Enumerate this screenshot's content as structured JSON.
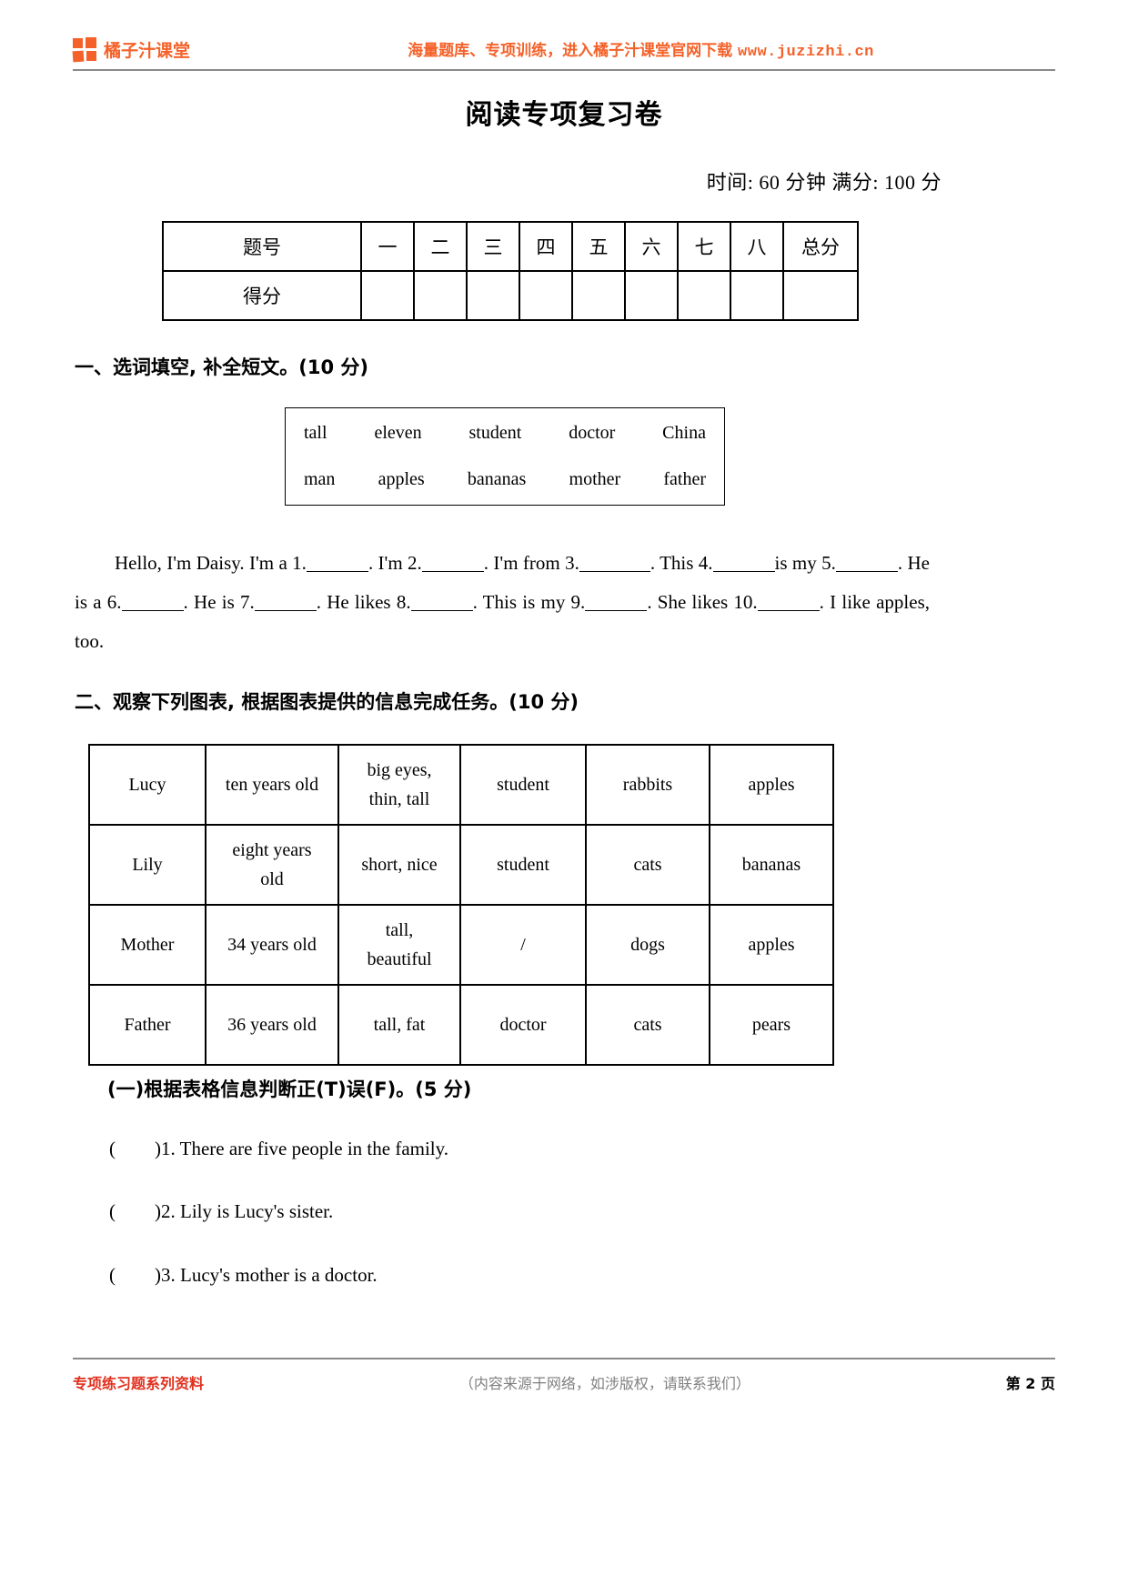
{
  "header": {
    "brand_name": "橘子汁课堂",
    "logo_icon": "four-square-grid-icon",
    "slogan": "海量题库、专项训练，进入橘子汁课堂官网下载",
    "url": "www.juzizhi.cn",
    "brand_color": "#f4622a"
  },
  "title": "阅读专项复习卷",
  "meta": "时间: 60 分钟    满分: 100 分",
  "score_table": {
    "row_labels": [
      "题号",
      "得分"
    ],
    "columns": [
      "一",
      "二",
      "三",
      "四",
      "五",
      "六",
      "七",
      "八",
      "总分"
    ],
    "scores": [
      "",
      "",
      "",
      "",
      "",
      "",
      "",
      "",
      ""
    ]
  },
  "section1": {
    "heading": "一、选词填空, 补全短文。(10 分)",
    "wordbank": {
      "row1": [
        "tall",
        "eleven",
        "student",
        "doctor",
        "China"
      ],
      "row2": [
        "man",
        "apples",
        "bananas",
        "mother",
        "father"
      ]
    },
    "passage": {
      "t1": "Hello, I'm Daisy. I'm a 1.",
      "t2": ". I'm 2.",
      "t3": ". I'm from 3.",
      "t4": ". This 4.",
      "t5": "is my   5.",
      "t6": ". He is a 6.",
      "t7": ". He is 7.",
      "t8": ". He likes 8.",
      "t9": ". This is my 9.",
      "t10": ". She likes 10.",
      "t11": ". I like apples, too."
    }
  },
  "section2": {
    "heading": "二、观察下列图表, 根据图表提供的信息完成任务。(10 分)",
    "table_rows": [
      [
        "Lucy",
        "ten years old",
        "big eyes,\nthin, tall",
        "student",
        "rabbits",
        "apples"
      ],
      [
        "Lily",
        "eight years\nold",
        "short, nice",
        "student",
        "cats",
        "bananas"
      ],
      [
        "Mother",
        "34 years old",
        "tall,\nbeautiful",
        "/",
        "dogs",
        "apples"
      ],
      [
        "Father",
        "36 years old",
        "tall, fat",
        "doctor",
        "cats",
        "pears"
      ]
    ],
    "sub_heading": "(一)根据表格信息判断正(T)误(F)。(5 分)",
    "tf_items": [
      ")1. There are five people in the family.",
      ")2. Lily is Lucy's sister.",
      ")3. Lucy's mother is a doctor."
    ]
  },
  "footer": {
    "left": "专项练习题系列资料",
    "center": "（内容来源于网络，如涉版权，请联系我们）",
    "right": "第 2 页"
  }
}
